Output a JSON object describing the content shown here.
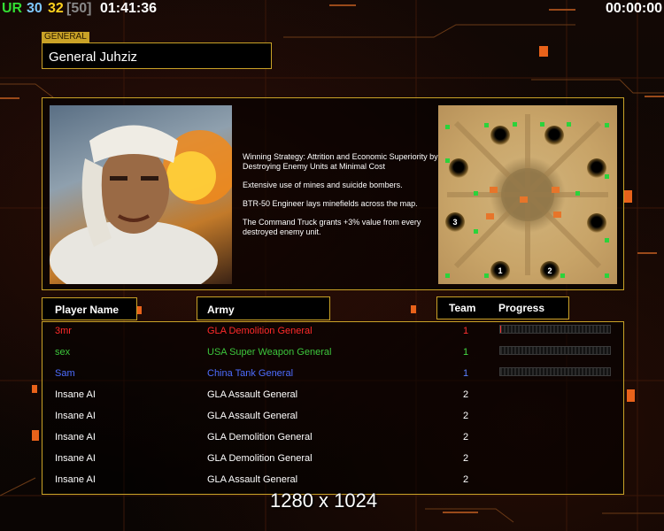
{
  "top_hud": {
    "ur_label": "UR",
    "stat1": "30",
    "stat2": "32",
    "stat3": "[50]",
    "clock_left": "01:41:36",
    "clock_right": "00:00:00"
  },
  "general": {
    "tag": "GENERAL",
    "name": "General Juhziz"
  },
  "description": [
    "Winning Strategy: Attrition and Economic Superiority by Destroying Enemy Units at Minimal Cost",
    "Extensive use of mines and suicide bombers.",
    "BTR-50 Engineer lays minefields across the map.",
    "The Command Truck grants +3% value from every destroyed enemy unit."
  ],
  "map": {
    "start_labels": [
      "1",
      "2",
      "3",
      "1"
    ]
  },
  "table": {
    "headers": {
      "player": "Player Name",
      "army": "Army",
      "team": "Team",
      "progress": "Progress"
    },
    "rows": [
      {
        "player": "3mr",
        "army": "GLA Demolition General",
        "team": "1",
        "color": "#ff2a2a",
        "team_color": "#ff3030",
        "progress": 0.01
      },
      {
        "player": "sex",
        "army": "USA Super Weapon General",
        "team": "1",
        "color": "#3cc63c",
        "team_color": "#44dd44",
        "progress": 0.0
      },
      {
        "player": "Sam",
        "army": "China Tank General",
        "team": "1",
        "color": "#4d6dff",
        "team_color": "#5a80ff",
        "progress": 0.0
      },
      {
        "player": "Insane AI",
        "army": "GLA Assault General",
        "team": "2",
        "color": "#ffffff",
        "team_color": "#ffffff"
      },
      {
        "player": "Insane AI",
        "army": "GLA Assault General",
        "team": "2",
        "color": "#ffffff",
        "team_color": "#ffffff"
      },
      {
        "player": "Insane AI",
        "army": "GLA Demolition General",
        "team": "2",
        "color": "#ffffff",
        "team_color": "#ffffff"
      },
      {
        "player": "Insane AI",
        "army": "GLA Demolition General",
        "team": "2",
        "color": "#ffffff",
        "team_color": "#ffffff"
      },
      {
        "player": "Insane AI",
        "army": "GLA Assault General",
        "team": "2",
        "color": "#ffffff",
        "team_color": "#ffffff"
      }
    ]
  },
  "watermark": "1280 x 1024",
  "colors": {
    "frame_gold": "#c9a227",
    "ur_green": "#33dd33",
    "stat_blue": "#7fc8ff",
    "stat_yellow": "#ffd21e",
    "stat_gray": "#888888"
  }
}
